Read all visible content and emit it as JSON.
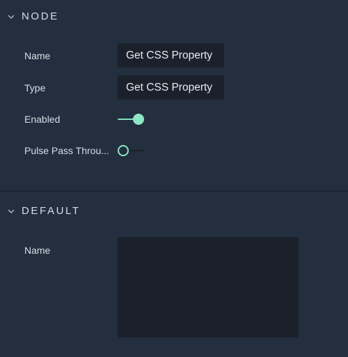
{
  "sections": {
    "node": {
      "title": "NODE",
      "fields": {
        "name": {
          "label": "Name",
          "value": "Get CSS Property"
        },
        "type": {
          "label": "Type",
          "value": "Get CSS Property"
        },
        "enabled": {
          "label": "Enabled",
          "state": "on"
        },
        "pulse_pass_through": {
          "label": "Pulse Pass Throu...",
          "state": "off"
        }
      }
    },
    "default": {
      "title": "DEFAULT",
      "fields": {
        "name": {
          "label": "Name",
          "value": ""
        }
      }
    }
  },
  "icons": {
    "collapse": "chevron-down-icon"
  },
  "colors": {
    "background": "#232e3e",
    "field_background": "#1b212b",
    "accent": "#8ee6c4"
  }
}
